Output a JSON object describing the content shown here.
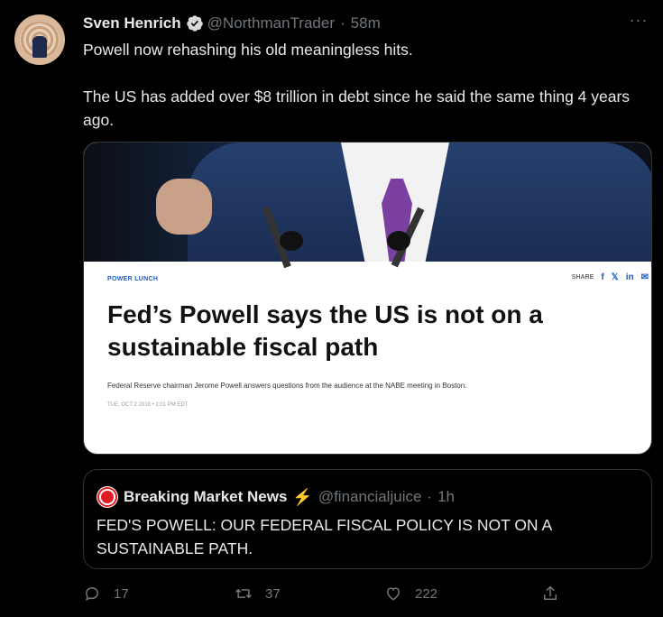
{
  "tweet": {
    "author_name": "Sven Henrich",
    "handle": "@NorthmanTrader",
    "separator": "·",
    "time": "58m",
    "more_label": "···",
    "text_lines": [
      "Powell now rehashing his old meaningless hits.",
      "The US has added over $8 trillion in debt since he said the same thing 4 years ago."
    ]
  },
  "media": {
    "kicker": "POWER LUNCH",
    "share_label": "SHARE",
    "share_icons": [
      "f",
      "𝕏",
      "in",
      "✉"
    ],
    "headline": "Fed’s Powell says the US is not on a sustainable fiscal path",
    "description": "Federal Reserve chairman Jerome Powell answers questions from the audience at the NABE meeting in Boston.",
    "date": "TUE, OCT 2 2018 • 1:01 PM EDT"
  },
  "quote": {
    "author_name": "Breaking Market News",
    "bolt": "⚡",
    "handle": "@financialjuice",
    "separator": "·",
    "time": "1h",
    "text": "FED'S POWELL: OUR FEDERAL FISCAL POLICY IS NOT ON A SUSTAINABLE PATH."
  },
  "actions": {
    "reply_count": "17",
    "retweet_count": "37",
    "like_count": "222"
  },
  "icons": {
    "verified": "verified-badge-icon",
    "reply": "reply-icon",
    "retweet": "retweet-icon",
    "like": "heart-icon",
    "share": "share-icon"
  },
  "colors": {
    "background": "#000000",
    "text": "#e7e9ea",
    "muted": "#71767b",
    "border": "#2f3336",
    "link_blue": "#1f5bc8",
    "bolt": "#f2c200"
  }
}
